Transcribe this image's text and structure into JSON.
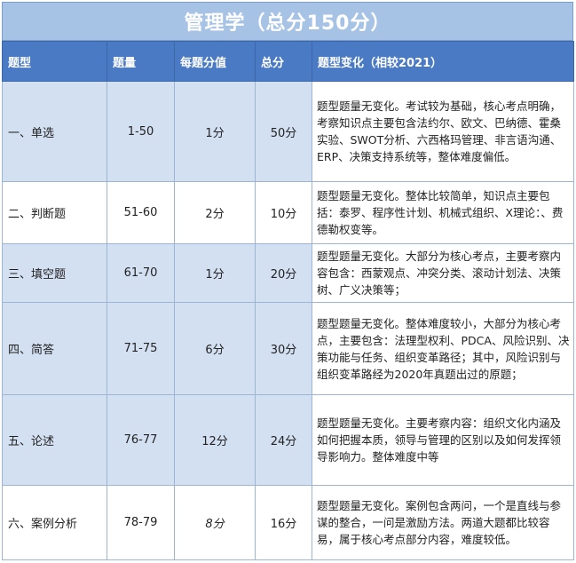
{
  "title": "管理学（总分150分）",
  "headers": [
    "题型",
    "题量",
    "每题分值",
    "总分",
    "题型变化（相较2021）"
  ],
  "rows": [
    {
      "type": "一、单选",
      "range": "1-50",
      "score": "1分",
      "total": "50分",
      "note": "题型题量无变化。考试较为基础，核心考点明确，考察知识点主要包含法约尔、欧文、巴纳德、霍桑实验、SWOT分析、六西格玛管理、非言语沟通、ERP、决策支持系统等，整体难度偏低。"
    },
    {
      "type": "二、判断题",
      "range": "51-60",
      "score": "2分",
      "total": "10分",
      "note": "题型题量无变化。整体比较简单，知识点主要包括：泰罗、程序性计划、机械式组织、X理论：、费德勒权变等。"
    },
    {
      "type": "三、填空题",
      "range": "61-70",
      "score": "1分",
      "total": "20分",
      "note": "题型题量无变化。大部分为核心考点，主要考察内容包含：西蒙观点、冲突分类、滚动计划法、决策树、广义决策等；"
    },
    {
      "type": "四、简答",
      "range": "71-75",
      "score": "6分",
      "total": "30分",
      "note": "题型题量无变化。整体难度较小，大部分为核心考点，主要包含：法理型权利、PDCA、风险识别、决策功能与任务、组织变革路径；其中，风险识别与组织变革路经为2020年真题出过的原题；"
    },
    {
      "type": "五、论述",
      "range": "76-77",
      "score": "12分",
      "total": "24分",
      "note": "题型题量无变化。主要考察内容：组织文化内涵及如何把握本质，领导与管理的区别以及如何发挥领导影响力。整体难度中等"
    },
    {
      "type": "六、案例分析",
      "range": "78-79",
      "score": "8分",
      "total": "16分",
      "note": "题型题量无变化。案例包含两问，一个是直线与参谋的整合，一问是激励方法。两道大题都比较容易，属于核心考点部分内容，难度较低。"
    }
  ]
}
